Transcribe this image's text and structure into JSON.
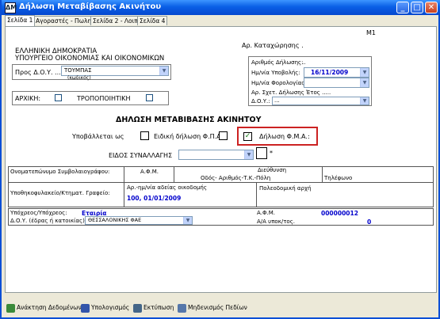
{
  "window": {
    "title": "Δήλωση Μεταβίβασης Ακινήτου",
    "min": "_",
    "max": "□",
    "close": "✕",
    "app_icon": "ΔΜ"
  },
  "tabs": [
    {
      "label": "Σελίδα 1",
      "active": true
    },
    {
      "label": "Αγοραστές - Πωλητές"
    },
    {
      "label": "Σελίδα 2 - Λοιπά"
    },
    {
      "label": "Σελίδα 4"
    }
  ],
  "form": {
    "code": "Μ1",
    "ministry1": "ΕΛΛΗΝΙΚΗ ΔΗΜΟΚΡΑΤΙΑ",
    "ministry2": "ΥΠΟΥΡΓΕΙΟ ΟΙΚΟΝΟΜΙΑΣ ΚΑΙ ΟΙΚΟΝΟΜΙΚΩΝ",
    "doy_label": "Προς Δ.Ο.Υ. ...",
    "doy_value": "ΤΟΥΜΠΑΣ",
    "doy_sub": "(κωδικός)",
    "arxiki": "ΑΡΧΙΚΗ:",
    "tropopoiitiki": "ΤΡΟΠΟΠΟΙΗΤΙΚΗ",
    "ar_katax": "Αρ. Καταχώρησης .",
    "ar_dilosis": "Αριθμός Δήλωσης:",
    "ar_dilosis_value": "..",
    "im_ypovolis": "Ημ/νία Υποβολής:",
    "im_ypovolis_value": "16/11/2009",
    "im_forol": "Ημ/νία Φορολογίας:",
    "ar_sxet": "Αρ. Σχετ. Δήλωσης Έτος .....",
    "doy_small": "Δ.Ο.Υ.:",
    "doy_small_value": "...",
    "heading": "ΔΗΛΩΣΗ ΜΕΤΑΒΙΒΑΣΗΣ ΑΚΙΝΗΤΟΥ",
    "ypovalletai": "Υποβάλλεται ως",
    "eidiki_fpa": "Ειδική δήλωση Φ.Π.Α.",
    "dilosi_fma": "Δήλωση Φ.Μ.Α.:",
    "eidos_label": "ΕΙΔΟΣ ΣΥΝΑΛΛΑΓΗΣ",
    "asterisk": "*"
  },
  "notary": {
    "name_label": "Ονοματεπώνυμο Συμβολαιογράφου:",
    "afm_label": "Α.Φ.Μ.",
    "address_label": "Διεύθυνση",
    "address_sub": "Οδός- Αριθμός-Τ.Κ.-Πόλη",
    "phone_label": "Τηλέφωνο",
    "ypothikofylakeio": "Υποθηκοφυλακείο/Κτηματ. Γραφείο:",
    "permit_label": "Αρ.-ημ/νία αδείας οικοδομής",
    "permit_value": "100, 01/01/2009",
    "poleodomiki": "Πολεοδομική αρχή"
  },
  "taxpayer": {
    "ypoxreos_label": "Υπόχρεος/Υπόχρεος:",
    "ypoxreos_value": "Εταιρία",
    "afm_label": "Α.Φ.Μ.",
    "afm_value": "000000012",
    "doy_label": "Δ.Ο.Υ. (έδρας ή κατοικίας)",
    "doy_value": "ΘΕΣΣΑΛΟΝΙΚΗΣ ΦΑΕ",
    "aa_label": "Α/Α υποκ/τος.",
    "aa_value": "0"
  },
  "toolbar": [
    {
      "label": "Ανάκτηση Δεδομένων",
      "color": "#3a8a3a"
    },
    {
      "label": "Υπολογισμός",
      "color": "#3355aa"
    },
    {
      "label": "Εκτύπωση",
      "color": "#446688"
    },
    {
      "label": "Μηδενισμός Πεδίων",
      "color": "#5577aa"
    }
  ]
}
